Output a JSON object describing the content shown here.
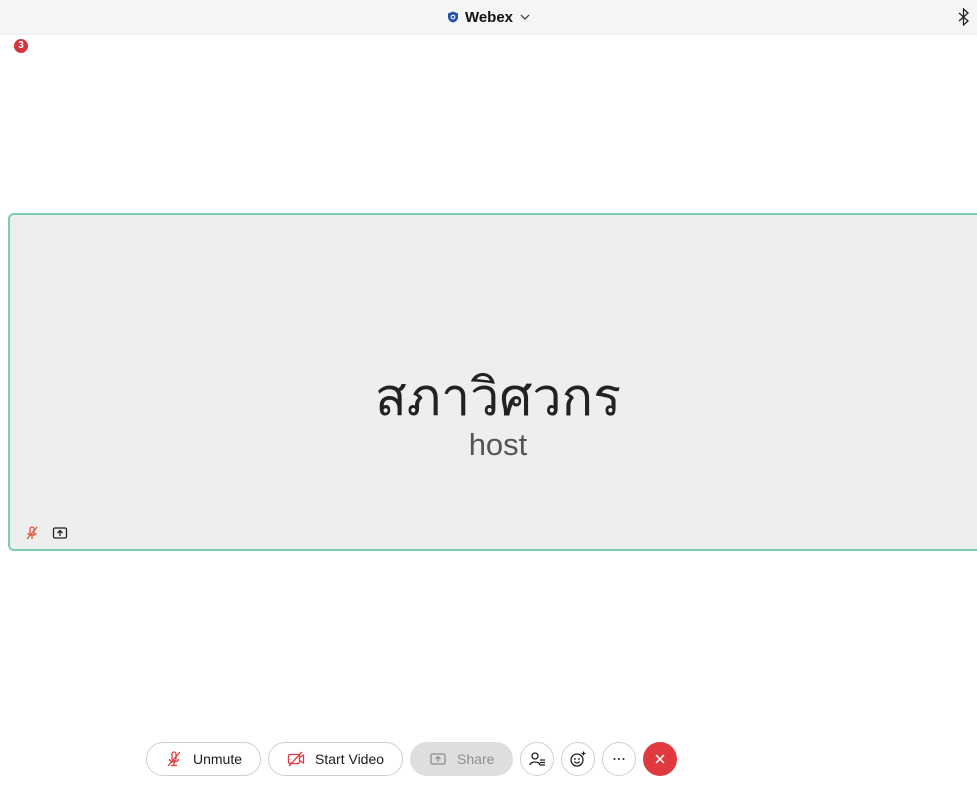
{
  "header": {
    "app_title": "Webex",
    "icons": [
      "shield-icon",
      "chevron-down-icon",
      "bluetooth-icon"
    ]
  },
  "notification": {
    "count": "3"
  },
  "video_tile": {
    "participant_name": "สภาวิศวกร",
    "participant_role": "host",
    "icons": [
      "mic-muted-icon",
      "share-icon"
    ]
  },
  "controls": {
    "unmute_label": "Unmute",
    "start_video_label": "Start Video",
    "share_label": "Share",
    "participants_icon": "participants-icon",
    "reactions_icon": "reactions-icon",
    "more_icon": "more-icon",
    "end_icon": "close-icon"
  },
  "colors": {
    "accent_tile_border": "#79cbb7",
    "danger": "#e03a3e",
    "muted_icon": "#e6533a",
    "topbar_bg": "#f5f5f5",
    "tile_bg": "#eeeeee"
  }
}
